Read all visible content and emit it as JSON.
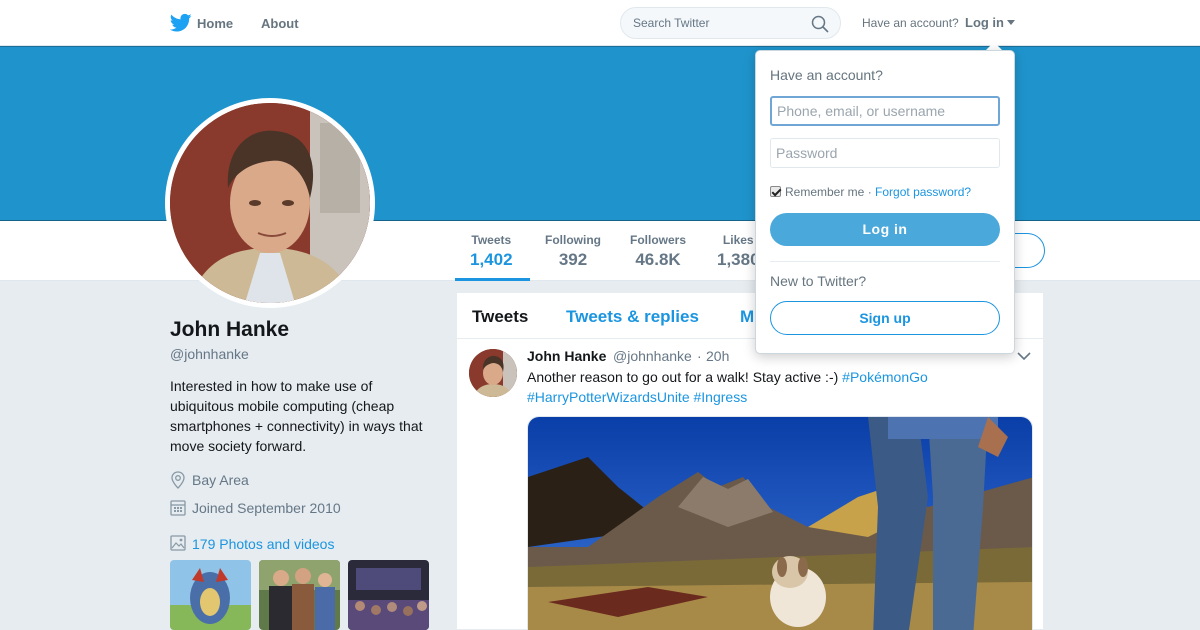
{
  "nav": {
    "home_label": "Home",
    "about_label": "About",
    "search_placeholder": "Search Twitter",
    "have_account": "Have an account?",
    "login_label": "Log in"
  },
  "profile": {
    "name": "John Hanke",
    "handle": "@johnhanke",
    "bio": "Interested in how to make use of ubiquitous mobile computing (cheap smartphones + connectivity) in ways that move society forward.",
    "location": "Bay Area",
    "joined": "Joined September 2010",
    "photos_link": "179 Photos and videos"
  },
  "stats": [
    {
      "label": "Tweets",
      "value": "1,402"
    },
    {
      "label": "Following",
      "value": "392"
    },
    {
      "label": "Followers",
      "value": "46.8K"
    },
    {
      "label": "Likes",
      "value": "1,380"
    }
  ],
  "timeline": {
    "tabs": [
      "Tweets",
      "Tweets & replies",
      "M"
    ]
  },
  "tweet": {
    "name": "John Hanke",
    "handle": "@johnhanke",
    "dot": "·",
    "time": "20h",
    "text": "Another reason to go out for a walk!  Stay active :-)",
    "hashtags": [
      "#PokémonGo",
      "#HarryPotterWizardsUnite",
      "#Ingress"
    ]
  },
  "login_dropdown": {
    "title": "Have an account?",
    "username_placeholder": "Phone, email, or username",
    "password_placeholder": "Password",
    "remember_me": "Remember me",
    "separator": "·",
    "forgot_password": "Forgot password?",
    "login_button": "Log in",
    "new_to_twitter": "New to Twitter?",
    "signup_button": "Sign up"
  },
  "colors": {
    "accent": "#1b95e0",
    "banner": "#1f94cc",
    "login_button": "#4aa8db"
  }
}
